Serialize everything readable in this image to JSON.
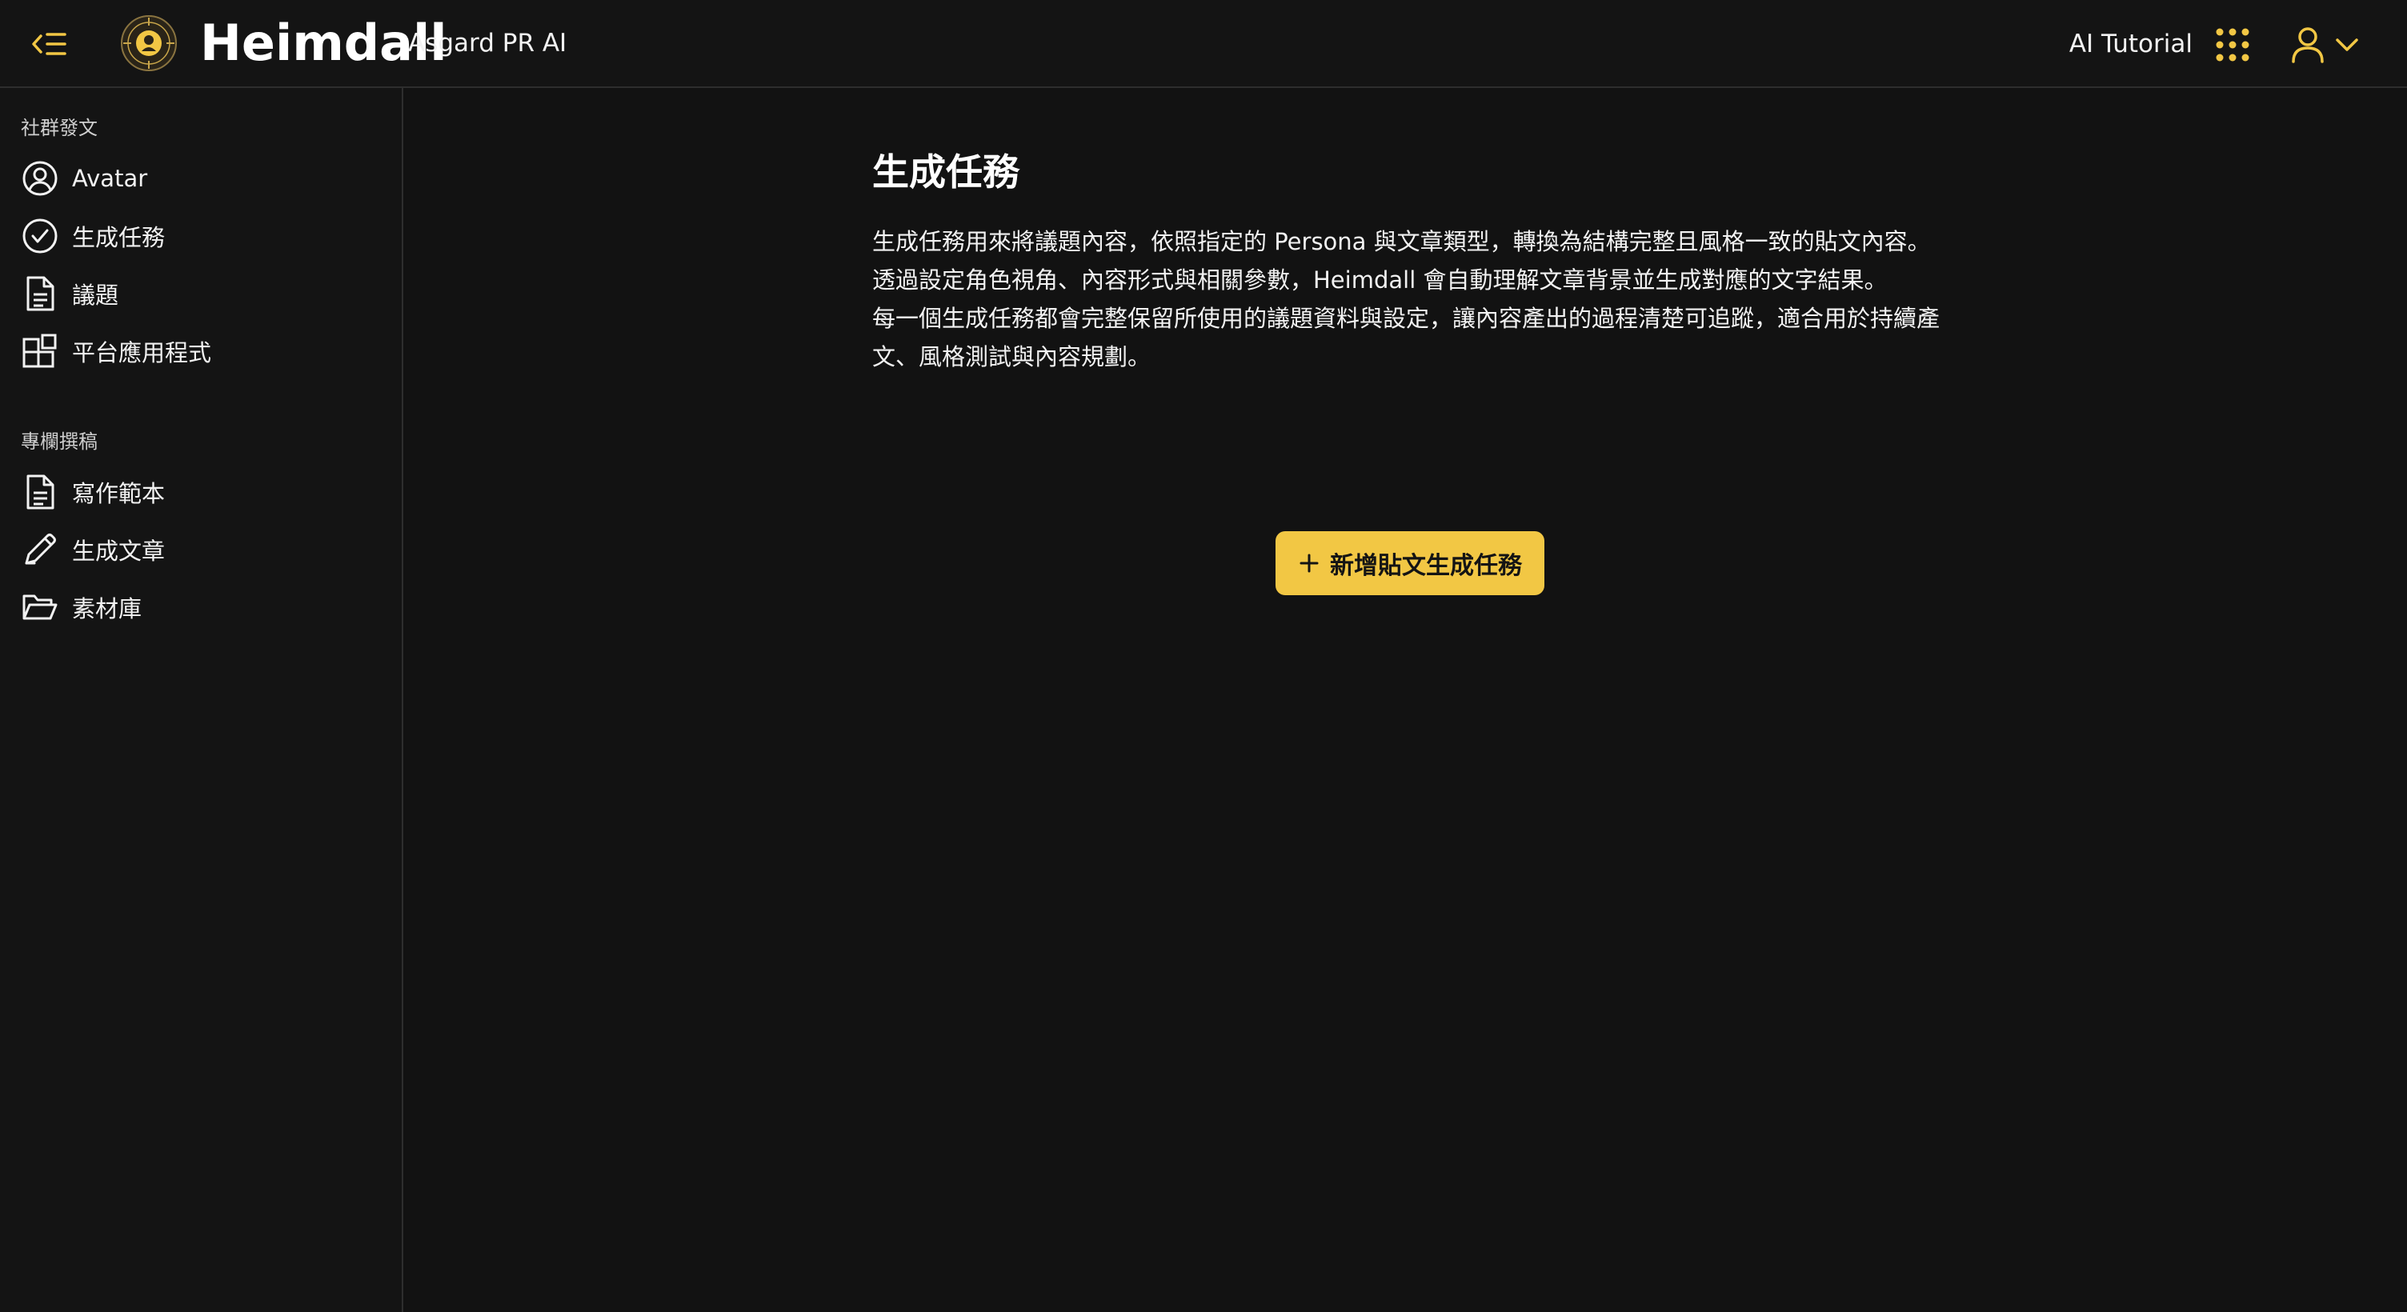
{
  "header": {
    "brand_name": "Heimdall",
    "brand_sub": "Asgard PR AI",
    "tutorial_label": "AI Tutorial",
    "icons": {
      "back": "collapse-menu-icon",
      "logo": "heimdall-logo",
      "apps": "apps-grid-icon",
      "user": "user-icon",
      "dropdown": "chevron-down-icon"
    }
  },
  "sidebar": {
    "sections": [
      {
        "label": "社群發文",
        "items": [
          {
            "label": "Avatar",
            "icon": "user-circle-icon"
          },
          {
            "label": "生成任務",
            "icon": "check-circle-icon"
          },
          {
            "label": "議題",
            "icon": "document-icon"
          },
          {
            "label": "平台應用程式",
            "icon": "apps-blocks-icon"
          }
        ]
      },
      {
        "label": "專欄撰稿",
        "items": [
          {
            "label": "寫作範本",
            "icon": "document-icon"
          },
          {
            "label": "生成文章",
            "icon": "pencil-icon"
          },
          {
            "label": "素材庫",
            "icon": "folder-open-icon"
          }
        ]
      }
    ]
  },
  "main": {
    "title": "生成任務",
    "description": [
      "生成任務用來將議題內容，依照指定的 Persona 與文章類型，轉換為結構完整且風格一致的貼文內容。",
      "透過設定角色視角、內容形式與相關參數，Heimdall 會自動理解文章背景並生成對應的文字結果。",
      "每一個生成任務都會完整保留所使用的議題資料與設定，讓內容產出的過程清楚可追蹤，適合用於持續產文、風格測試與內容規劃。"
    ],
    "add_button_label": "新增貼文生成任務",
    "add_button_icon": "plus-icon"
  },
  "colors": {
    "accent": "#f2c744",
    "background": "#121212",
    "panel": "#141414",
    "divider": "#2e2e2e",
    "text": "#f2f2f2"
  }
}
